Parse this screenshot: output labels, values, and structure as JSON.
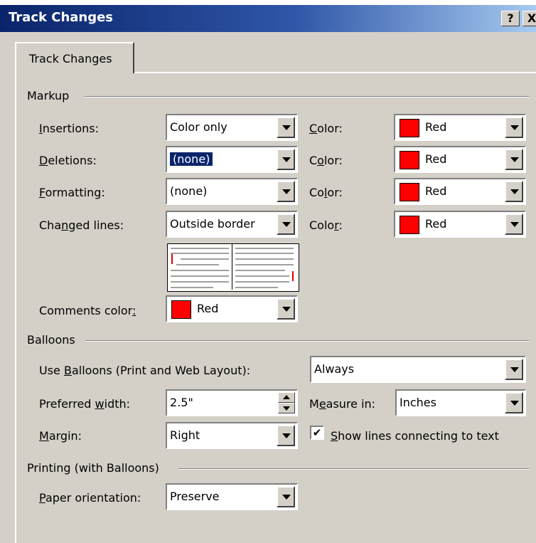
{
  "window": {
    "title": "Track Changes",
    "help_label": "?",
    "close_label": "X"
  },
  "tab": {
    "label": "Track Changes"
  },
  "markup": {
    "heading": "Markup",
    "insertions": {
      "label_pre": "",
      "label_key": "I",
      "label_post": "nsertions:",
      "value": "Color only",
      "color_label_pre": "",
      "color_label_key": "C",
      "color_label_post": "olor:",
      "color": "Red"
    },
    "deletions": {
      "label_pre": "",
      "label_key": "D",
      "label_post": "eletions:",
      "value": "(none)",
      "color_label_pre": "C",
      "color_label_key": "o",
      "color_label_post": "lor:",
      "color": "Red"
    },
    "formatting": {
      "label_pre": "",
      "label_key": "F",
      "label_post": "ormatting:",
      "value": "(none)",
      "color_label_pre": "Co",
      "color_label_key": "l",
      "color_label_post": "or:",
      "color": "Red"
    },
    "changed_lines": {
      "label_pre": "Cha",
      "label_key": "n",
      "label_post": "ged lines:",
      "value": "Outside border",
      "color_label_pre": "Colo",
      "color_label_key": "r",
      "color_label_post": ":",
      "color": "Red"
    },
    "comments": {
      "label_pre": "Comments color",
      "label_key": ":",
      "color": "Red"
    }
  },
  "balloons": {
    "heading": "Balloons",
    "use_label_pre": "Use ",
    "use_label_key": "B",
    "use_label_post": "alloons (Print and Web Layout):",
    "use_value": "Always",
    "width_label_pre": "Preferred ",
    "width_label_key": "w",
    "width_label_post": "idth:",
    "width_value": "2.5\"",
    "measure_label_pre": "M",
    "measure_label_key": "e",
    "measure_label_post": "asure in:",
    "measure_value": "Inches",
    "margin_label_pre": "",
    "margin_label_key": "M",
    "margin_label_post": "argin:",
    "margin_value": "Right",
    "show_lines_label_pre": "",
    "show_lines_label_key": "S",
    "show_lines_label_post": "how lines connecting to text",
    "show_lines_checked": "✔"
  },
  "printing": {
    "heading": "Printing (with Balloons)",
    "orientation_label_pre": "",
    "orientation_label_key": "P",
    "orientation_label_post": "aper orientation:",
    "orientation_value": "Preserve"
  },
  "colors": {
    "accent": "#0a246a",
    "swatch": "#ff0000",
    "dialog": "#d4d0c8"
  }
}
